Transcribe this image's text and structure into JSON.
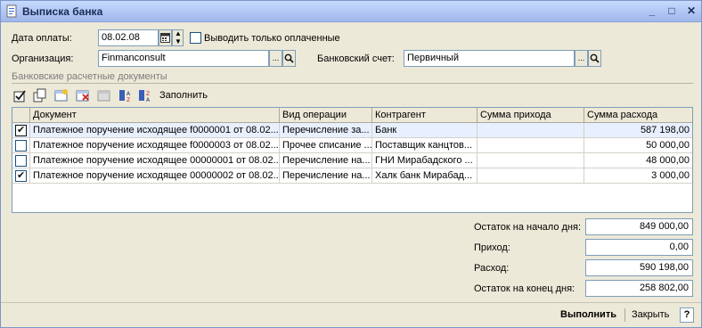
{
  "window": {
    "title": "Выписка банка",
    "controls": {
      "minimize": "_",
      "maximize": "□",
      "close": "✕"
    }
  },
  "form": {
    "date_label": "Дата оплаты:",
    "date_value": "08.02.08",
    "only_paid_label": "Выводить только оплаченные",
    "only_paid_checked": false,
    "org_label": "Организация:",
    "org_value": "Finmanconsult",
    "account_label": "Банковский счет:",
    "account_value": "Первичный",
    "select_button": "...",
    "section_title": "Банковские расчетные документы",
    "fill_label": "Заполнить"
  },
  "table": {
    "columns": [
      "Документ",
      "Вид операции",
      "Контрагент",
      "Сумма прихода",
      "Сумма расхода"
    ],
    "rows": [
      {
        "checked": true,
        "doc": "Платежное поручение исходящее f0000001 от 08.02....",
        "op": "Перечисление за...",
        "party": "Банк",
        "income": "",
        "expense": "587 198,00"
      },
      {
        "checked": false,
        "doc": "Платежное поручение исходящее f0000003 от 08.02....",
        "op": "Прочее списание ...",
        "party": "Поставщик канцтов...",
        "income": "",
        "expense": "50 000,00"
      },
      {
        "checked": false,
        "doc": "Платежное поручение исходящее 00000001 от 08.02....",
        "op": "Перечисление на...",
        "party": "ГНИ Мирабадского ...",
        "income": "",
        "expense": "48 000,00"
      },
      {
        "checked": true,
        "doc": "Платежное поручение исходящее 00000002 от 08.02....",
        "op": "Перечисление на...",
        "party": "Халк банк Мирабад...",
        "income": "",
        "expense": "3 000,00"
      }
    ]
  },
  "totals": {
    "start_label": "Остаток на начало дня:",
    "start_value": "849 000,00",
    "income_label": "Приход:",
    "income_value": "0,00",
    "expense_label": "Расход:",
    "expense_value": "590 198,00",
    "end_label": "Остаток на конец дня:",
    "end_value": "258 802,00"
  },
  "footer": {
    "execute_label": "Выполнить",
    "close_label": "Закрыть",
    "help_label": "?"
  },
  "colors": {
    "titlebar": "#9fb7ea",
    "window_bg": "#ece9d8",
    "border": "#7f9db9"
  }
}
